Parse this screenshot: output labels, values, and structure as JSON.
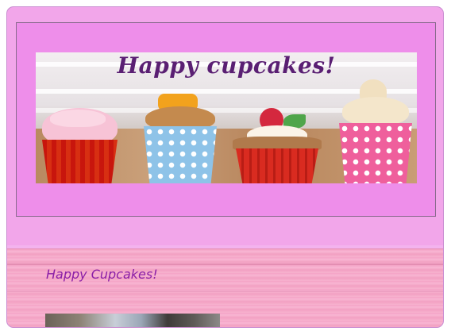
{
  "banner": {
    "title": "Happy cupcakes!"
  },
  "section": {
    "title": "Happy Cupcakes!"
  },
  "colors": {
    "frame_bg": "#f2a6ea",
    "header_panel_bg": "#ee8eea",
    "title_color": "#5a1f73",
    "section_title_color": "#8b1ea6",
    "wood_pink": "#f7b2cf"
  }
}
